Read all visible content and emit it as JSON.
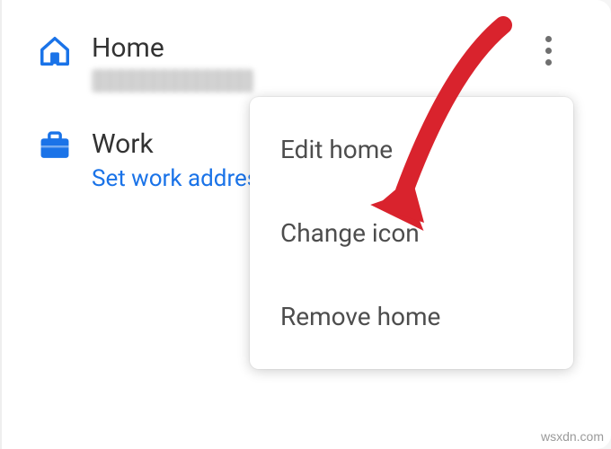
{
  "places": {
    "home": {
      "label": "Home",
      "icon": "home-icon",
      "subtitle_redacted": true
    },
    "work": {
      "label": "Work",
      "icon": "briefcase-icon",
      "link_text": "Set work address"
    }
  },
  "menu": {
    "items": [
      {
        "label": "Edit home"
      },
      {
        "label": "Change icon"
      },
      {
        "label": "Remove home"
      }
    ],
    "highlighted_index": 1
  },
  "colors": {
    "accent": "#1a73e8",
    "text": "#333333",
    "menu_text": "#4d4d4d",
    "arrow": "#d9232d"
  },
  "watermark": "wsxdn.com"
}
